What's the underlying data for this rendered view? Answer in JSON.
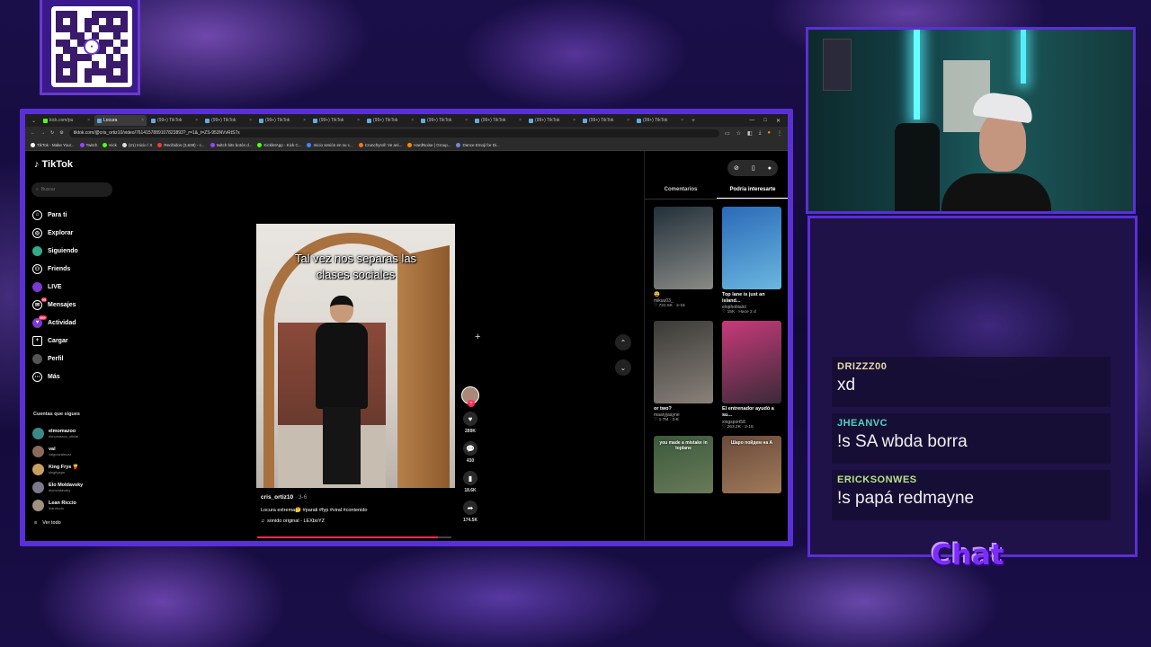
{
  "browser": {
    "tabs": [
      {
        "label": "kick.com/pu",
        "active": false
      },
      {
        "label": "Locura",
        "active": true
      },
      {
        "label": "(99+) TikTok",
        "active": false
      },
      {
        "label": "(99+) TikTok",
        "active": false
      },
      {
        "label": "(99+) TikTok",
        "active": false
      },
      {
        "label": "(99+) TikTok",
        "active": false
      },
      {
        "label": "(99+) TikTok",
        "active": false
      },
      {
        "label": "(99+) TikTok",
        "active": false
      },
      {
        "label": "(99+) TikTok",
        "active": false
      },
      {
        "label": "(99+) TikTok",
        "active": false
      },
      {
        "label": "(99+) TikTok",
        "active": false
      },
      {
        "label": "(99+) TikTok",
        "active": false
      }
    ],
    "url": "tiktok.com/@cris_ortiz10/video/7614157889107823893?_r=1&_t=ZS-953NVvRtS7s",
    "bookmarks": [
      "TikTok - Make Your...",
      "Twitch",
      "Kick",
      "(21) Inicio / X",
      "Recibidos (3,638) - c...",
      "twitch bits botón d...",
      "KickletApp - Kick C...",
      "Inicio sesión en su c...",
      "Crunchyroll: Ve ani...",
      "HardNoise | Group...",
      "Dance Emoji for Di..."
    ]
  },
  "tiktok": {
    "logo": "TikTok",
    "search_placeholder": "Buscar",
    "nav": [
      {
        "label": "Para ti",
        "icon": "home-icon"
      },
      {
        "label": "Explorar",
        "icon": "compass-icon"
      },
      {
        "label": "Siguiendo",
        "icon": "following-icon"
      },
      {
        "label": "Friends",
        "icon": "friends-icon"
      },
      {
        "label": "LIVE",
        "icon": "live-icon"
      },
      {
        "label": "Mensajes",
        "icon": "messages-icon",
        "badge": "99"
      },
      {
        "label": "Actividad",
        "icon": "activity-icon",
        "badge": "99+"
      },
      {
        "label": "Cargar",
        "icon": "upload-icon"
      },
      {
        "label": "Perfil",
        "icon": "profile-icon"
      },
      {
        "label": "Más",
        "icon": "more-icon"
      }
    ],
    "following_title": "Cuentas que sigues",
    "following": [
      {
        "name": "elmomazoo",
        "user": "elmomazoo_oficial"
      },
      {
        "name": "val",
        "user": "valgonzalezzz"
      },
      {
        "name": "King Frys 🍟",
        "user": "kingfryspe"
      },
      {
        "name": "Elo Moldavsky",
        "user": "elomoldavsky"
      },
      {
        "name": "Lean Riccio",
        "user": "leanriccio"
      }
    ],
    "see_all": "Ver todo",
    "video": {
      "caption_line1": "Tal vez nos separas las",
      "caption_line2": "clases sociales",
      "author": "cris_ortiz10",
      "date": "· 3-6",
      "description": "Locura extrema🤔 #parati #fyp #viral #contenido",
      "sound": "sonido original - LEXboYZ",
      "progress": 0.93
    },
    "actions": [
      {
        "icon": "heart-icon",
        "count": "289K"
      },
      {
        "icon": "comment-icon",
        "count": "430"
      },
      {
        "icon": "bookmark-icon",
        "count": "18.6K"
      },
      {
        "icon": "share-icon",
        "count": "174.5K"
      }
    ],
    "panel_tabs": [
      "Comentarios",
      "Podría interesarte"
    ],
    "recommended": [
      {
        "title": "😩",
        "user": "mikuu03_",
        "stats": "♡ 731.5K · 2-15",
        "colors": [
          "#22303a",
          "#8a8a86"
        ]
      },
      {
        "title": "Top lane is just an island...",
        "user": "elophobialol",
        "stats": "♡ 15K · Hace 2 d",
        "colors": [
          "#2a6ab8",
          "#6ab7e0"
        ]
      },
      {
        "title": "or two?",
        "user": "maaryjaayne",
        "stats": "♡ 1.7M · 3-6",
        "colors": [
          "#3a3a36",
          "#8a817a"
        ]
      },
      {
        "title": "El entrenador ayudó a su...",
        "user": "xingsport58",
        "stats": "♡ 263.2K · 2-16",
        "colors": [
          "#c83a7a",
          "#3a2a38"
        ]
      },
      {
        "title": "you made a mistake in toplane",
        "user": "",
        "stats": "",
        "colors": [
          "#3a5a3a",
          "#6a7a5a"
        ]
      },
      {
        "title": "Шаро пойдем на А",
        "user": "",
        "stats": "",
        "colors": [
          "#6a4a3a",
          "#a07a5a"
        ]
      }
    ]
  },
  "chat": {
    "messages": [
      {
        "user": "DRIZZZ00",
        "text": "xd",
        "color": "#e8d9a8"
      },
      {
        "user": "JHEANVC",
        "text": "!s SA wbda borra",
        "color": "#4fd1c5"
      },
      {
        "user": "ERICKSONWES",
        "text": "!s papá redmayne",
        "color": "#b6e28a"
      }
    ],
    "label": "Chat"
  }
}
